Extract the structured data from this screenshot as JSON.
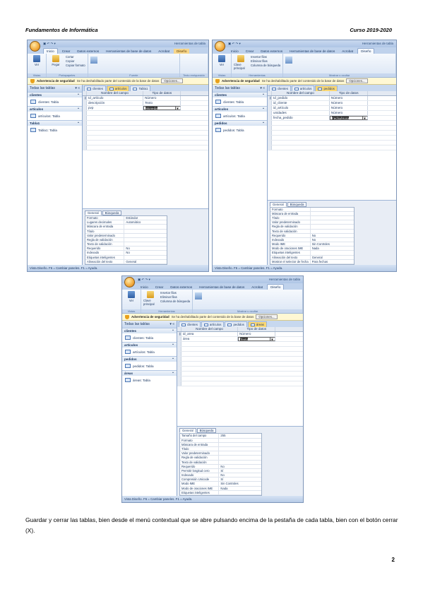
{
  "header": {
    "left": "Fundamentos de Informática",
    "right": "Curso 2019-2020"
  },
  "screenshots": [
    {
      "window_title": "Herramientas de tabla",
      "qat": "▣ ↶ ↷ ▾",
      "tabs": [
        "Inicio",
        "Crear",
        "Datos externos",
        "Herramientas de base de datos",
        "Acrobat",
        "Diseño"
      ],
      "active_tab": "Inicio",
      "ribbon": {
        "btn1": "Ver",
        "btn2": "Pegar",
        "clip": [
          "Cortar",
          "Copiar",
          "Copiar formato"
        ],
        "group1": "Vistas",
        "group2": "Portapapeles",
        "group3": "Fuente",
        "group4": "Texto enriquecido"
      },
      "security": {
        "title": "Advertencia de seguridad",
        "text": "Se ha deshabilitado parte del contenido de la base de datos",
        "button": "Opciones..."
      },
      "nav": {
        "title": "Todas las tablas",
        "groups": [
          {
            "name": "clientes",
            "items": [
              "clientes: Tabla"
            ]
          },
          {
            "name": "artículos",
            "items": [
              "artículos: Tabla"
            ]
          },
          {
            "name": "Tabla1",
            "items": [
              "Tabla1: Tabla"
            ]
          }
        ]
      },
      "doctabs": [
        "clientes",
        "artículos",
        "Tabla1"
      ],
      "active_doctab": "artículos",
      "grid_head": [
        "Nombre del campo",
        "Tipo de datos"
      ],
      "rows": [
        {
          "field": "Id_artículo",
          "type": "Número",
          "key": true
        },
        {
          "field": "descripción",
          "type": "Texto"
        },
        {
          "field": "pvp",
          "type": "Moneda",
          "selected": true
        }
      ],
      "prop_tabs": [
        "General",
        "Búsqueda"
      ],
      "props": [
        [
          "Formato",
          "Estándar"
        ],
        [
          "Lugares decimales",
          "Automático"
        ],
        [
          "Máscara de entrada",
          ""
        ],
        [
          "Título",
          ""
        ],
        [
          "Valor predeterminado",
          ""
        ],
        [
          "Regla de validación",
          ""
        ],
        [
          "Texto de validación",
          ""
        ],
        [
          "Requerido",
          "No"
        ],
        [
          "Indexado",
          "No"
        ],
        [
          "Etiquetas inteligentes",
          ""
        ],
        [
          "Alineación del texto",
          "General"
        ]
      ],
      "status": "Vista Diseño.  F6 = Cambiar paneles.  F1 = Ayuda."
    },
    {
      "window_title": "Herramientas de tabla",
      "qat": "▣ ↶ ↷ ▾",
      "tabs": [
        "Inicio",
        "Crear",
        "Datos externos",
        "Herramientas de base de datos",
        "Acrobat",
        "Diseño"
      ],
      "active_tab": "Diseño",
      "ribbon": {
        "btn1": "Ver",
        "btn2": "Clave principal",
        "clip": [
          "Insertar filas",
          "Eliminar filas",
          "Columna de búsqueda"
        ],
        "group1": "Vistas",
        "group2": "Herramientas",
        "group3": "Mostrar u ocultar",
        "group4": ""
      },
      "security": {
        "title": "Advertencia de seguridad",
        "text": "Se ha deshabilitado parte del contenido de la base de datos",
        "button": "Opciones..."
      },
      "nav": {
        "title": "Todas las tablas",
        "groups": [
          {
            "name": "clientes",
            "items": [
              "clientes: Tabla"
            ]
          },
          {
            "name": "artículos",
            "items": [
              "artículos: Tabla"
            ]
          },
          {
            "name": "pedidos",
            "items": [
              "pedidos: Tabla"
            ]
          }
        ]
      },
      "doctabs": [
        "clientes",
        "artículos",
        "pedidos"
      ],
      "active_doctab": "pedidos",
      "grid_head": [
        "Nombre del campo",
        "Tipo de datos"
      ],
      "rows": [
        {
          "field": "Id_pedido",
          "type": "Número",
          "key": true
        },
        {
          "field": "id_cliente",
          "type": "Número"
        },
        {
          "field": "id_artículo",
          "type": "Número"
        },
        {
          "field": "unidades",
          "type": "Número"
        },
        {
          "field": "fecha_pedido",
          "type": "Fecha/Hora",
          "selected": true
        }
      ],
      "prop_tabs": [
        "General",
        "Búsqueda"
      ],
      "props": [
        [
          "Formato",
          ""
        ],
        [
          "Máscara de entrada",
          ""
        ],
        [
          "Título",
          ""
        ],
        [
          "Valor predeterminado",
          ""
        ],
        [
          "Regla de validación",
          ""
        ],
        [
          "Texto de validación",
          ""
        ],
        [
          "Requerido",
          "No"
        ],
        [
          "Indexado",
          "No"
        ],
        [
          "Modo IME",
          "Sin Controles"
        ],
        [
          "Modo de oraciones IME",
          "Nada"
        ],
        [
          "Etiquetas inteligentes",
          ""
        ],
        [
          "Alineación del texto",
          "General"
        ],
        [
          "Mostrar el selector de fecha",
          "Para fechas"
        ]
      ],
      "status": "Vista Diseño.  F6 = Cambiar paneles.  F1 = Ayuda."
    },
    {
      "window_title": "Herramientas de tabla",
      "qat": "▣ ↶ ↷ ▾",
      "tabs": [
        "Inicio",
        "Crear",
        "Datos externos",
        "Herramientas de base de datos",
        "Acrobat",
        "Diseño"
      ],
      "active_tab": "Diseño",
      "ribbon": {
        "btn1": "Ver",
        "btn2": "Clave principal",
        "clip": [
          "Insertar filas",
          "Eliminar filas",
          "Columna de búsqueda"
        ],
        "group1": "Vistas",
        "group2": "Herramientas",
        "group3": "Mostrar u ocultar",
        "group4": ""
      },
      "security": {
        "title": "Advertencia de seguridad",
        "text": "Se ha deshabilitado parte del contenido de la base de datos",
        "button": "Opciones..."
      },
      "nav": {
        "title": "Todas las tablas",
        "groups": [
          {
            "name": "clientes",
            "items": [
              "clientes: Tabla"
            ]
          },
          {
            "name": "artículos",
            "items": [
              "artículos: Tabla"
            ]
          },
          {
            "name": "pedidos",
            "items": [
              "pedidos: Tabla"
            ]
          },
          {
            "name": "áreas",
            "items": [
              "áreas: Tabla"
            ]
          }
        ]
      },
      "doctabs": [
        "clientes",
        "artículos",
        "pedidos",
        "áreas"
      ],
      "active_doctab": "áreas",
      "grid_head": [
        "Nombre del campo",
        "Tipo de datos"
      ],
      "rows": [
        {
          "field": "id_area",
          "type": "Número",
          "key": true
        },
        {
          "field": "área",
          "type": "Texto",
          "selected": true
        }
      ],
      "prop_tabs": [
        "General",
        "Búsqueda"
      ],
      "props": [
        [
          "Tamaño del campo",
          "255"
        ],
        [
          "Formato",
          ""
        ],
        [
          "Máscara de entrada",
          ""
        ],
        [
          "Título",
          ""
        ],
        [
          "Valor predeterminado",
          ""
        ],
        [
          "Regla de validación",
          ""
        ],
        [
          "Texto de validación",
          ""
        ],
        [
          "Requerido",
          "No"
        ],
        [
          "Permitir longitud cero",
          "Sí"
        ],
        [
          "Indexado",
          "No"
        ],
        [
          "Compresión Unicode",
          "Sí"
        ],
        [
          "Modo IME",
          "Sin Controles"
        ],
        [
          "Modo de oraciones IME",
          "Nada"
        ],
        [
          "Etiquetas inteligentes",
          ""
        ]
      ],
      "status": "Vista Diseño.  F6 = Cambiar paneles.  F1 = Ayuda."
    }
  ],
  "caption": "Guardar y cerrar las tablas, bien desde el menú contextual que se abre pulsando encima de la pestaña de cada tabla, bien con el botón cerrar (X).",
  "page_number": "2",
  "colors": {
    "accent": "#fbd874",
    "ribbon": "#dbe6f5",
    "frame": "#7d95b8"
  }
}
